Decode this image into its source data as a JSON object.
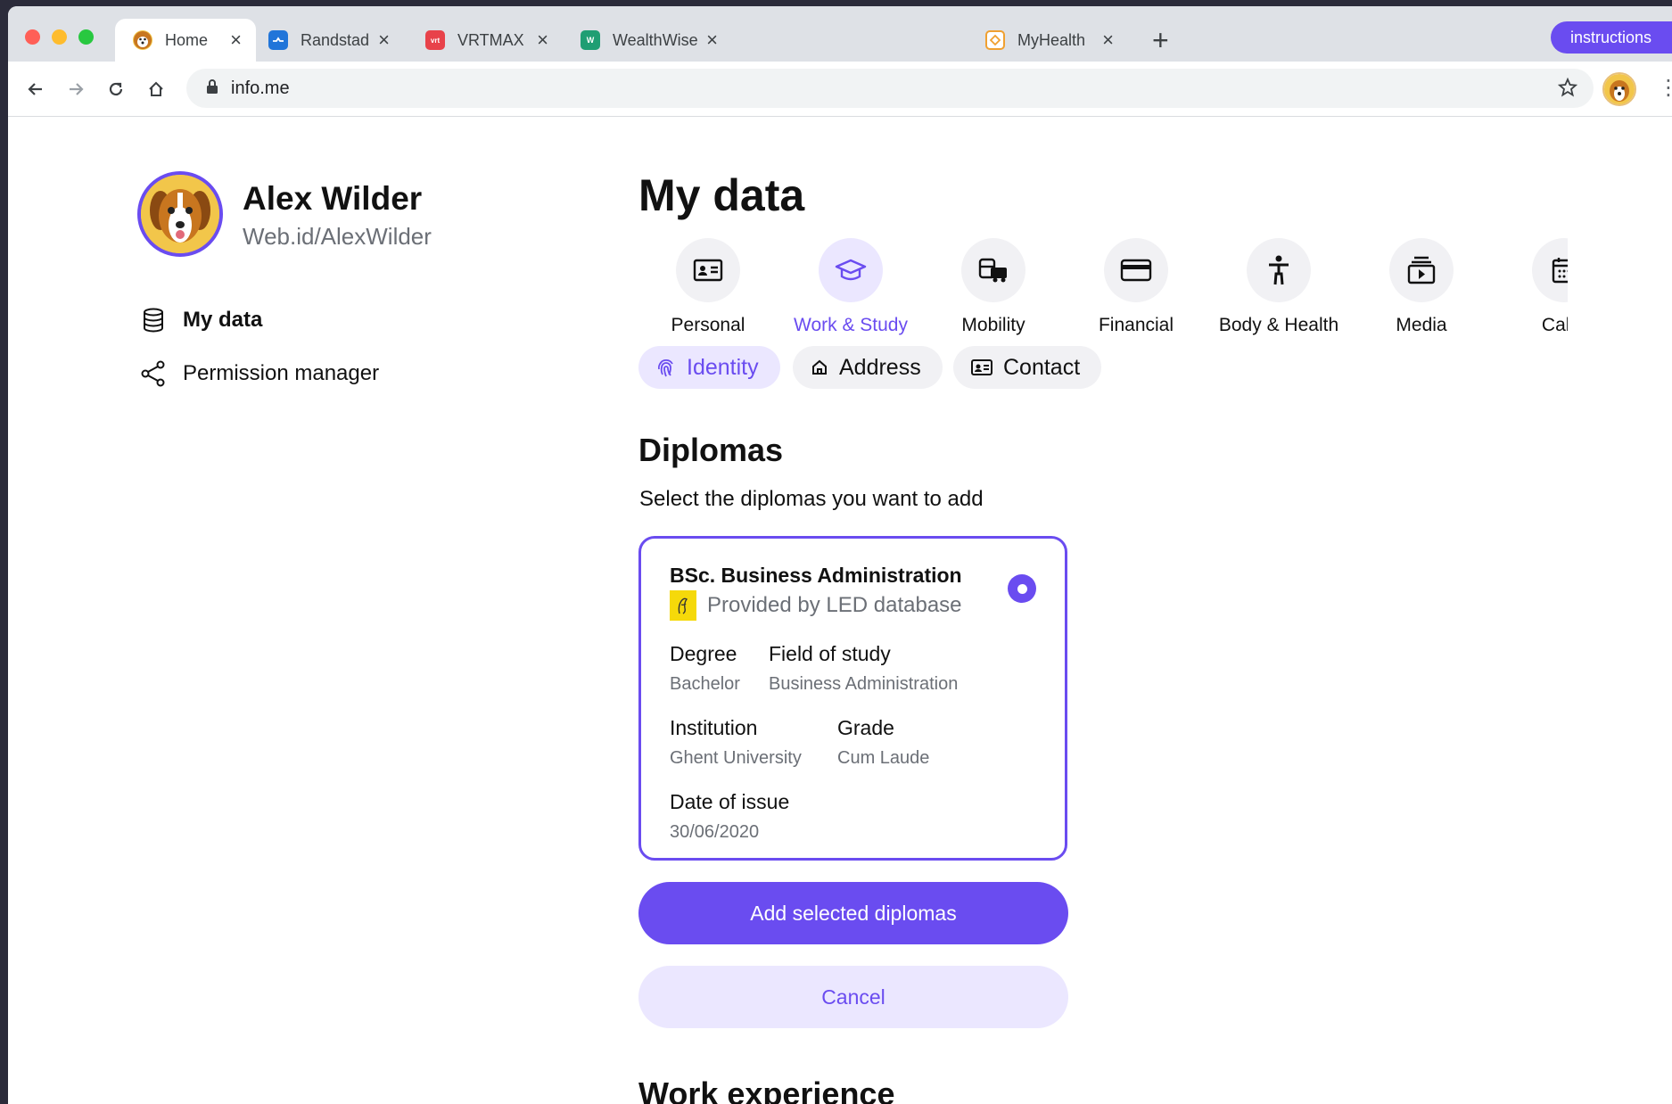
{
  "browser": {
    "tabs": [
      {
        "label": "Home",
        "icon": "dog-avatar-icon",
        "active": true
      },
      {
        "label": "Randstad",
        "icon": "randstad-icon",
        "color": "#2175d9"
      },
      {
        "label": "VRTMAX",
        "icon": "vrtmax-icon",
        "color": "#e8424a"
      },
      {
        "label": "WealthWise",
        "icon": "wealthwise-icon",
        "color": "#1f9e73"
      },
      {
        "label": "MyHealth",
        "icon": "myhealth-icon",
        "color": "#f0a030"
      }
    ],
    "url": "info.me",
    "instructions_label": "instructions"
  },
  "user": {
    "name": "Alex Wilder",
    "web_id": "Web.id/AlexWilder"
  },
  "sidebar": {
    "items": [
      {
        "label": "My data",
        "icon": "database-icon",
        "active": true
      },
      {
        "label": "Permission manager",
        "icon": "share-icon",
        "active": false
      }
    ]
  },
  "main": {
    "title": "My data",
    "categories": [
      {
        "label": "Personal",
        "icon": "id-card-icon"
      },
      {
        "label": "Work & Study",
        "icon": "graduation-cap-icon",
        "active": true
      },
      {
        "label": "Mobility",
        "icon": "vehicles-icon"
      },
      {
        "label": "Financial",
        "icon": "credit-card-icon"
      },
      {
        "label": "Body & Health",
        "icon": "accessibility-icon"
      },
      {
        "label": "Media",
        "icon": "media-play-icon"
      },
      {
        "label": "Caler",
        "icon": "calendar-icon"
      }
    ],
    "chips": [
      {
        "label": "Identity",
        "icon": "fingerprint-icon",
        "active": true
      },
      {
        "label": "Address",
        "icon": "home-icon"
      },
      {
        "label": "Contact",
        "icon": "contact-card-icon"
      }
    ],
    "section_title": "Diplomas",
    "section_subtitle": "Select the diplomas you want to add",
    "diploma": {
      "title": "BSc. Business Administration",
      "provider": "Provided by LED database",
      "selected": true,
      "degree_label": "Degree",
      "degree_value": "Bachelor",
      "field_label": "Field of study",
      "field_value": "Business Administration",
      "institution_label": "Institution",
      "institution_value": "Ghent University",
      "grade_label": "Grade",
      "grade_value": "Cum Laude",
      "date_label": "Date of issue",
      "date_value": "30/06/2020"
    },
    "add_button": "Add selected diplomas",
    "cancel_button": "Cancel",
    "next_section_title": "Work experience"
  },
  "colors": {
    "accent": "#6a4cf0",
    "accent_light": "#ebe7ff",
    "muted_text": "#6b6f76"
  }
}
